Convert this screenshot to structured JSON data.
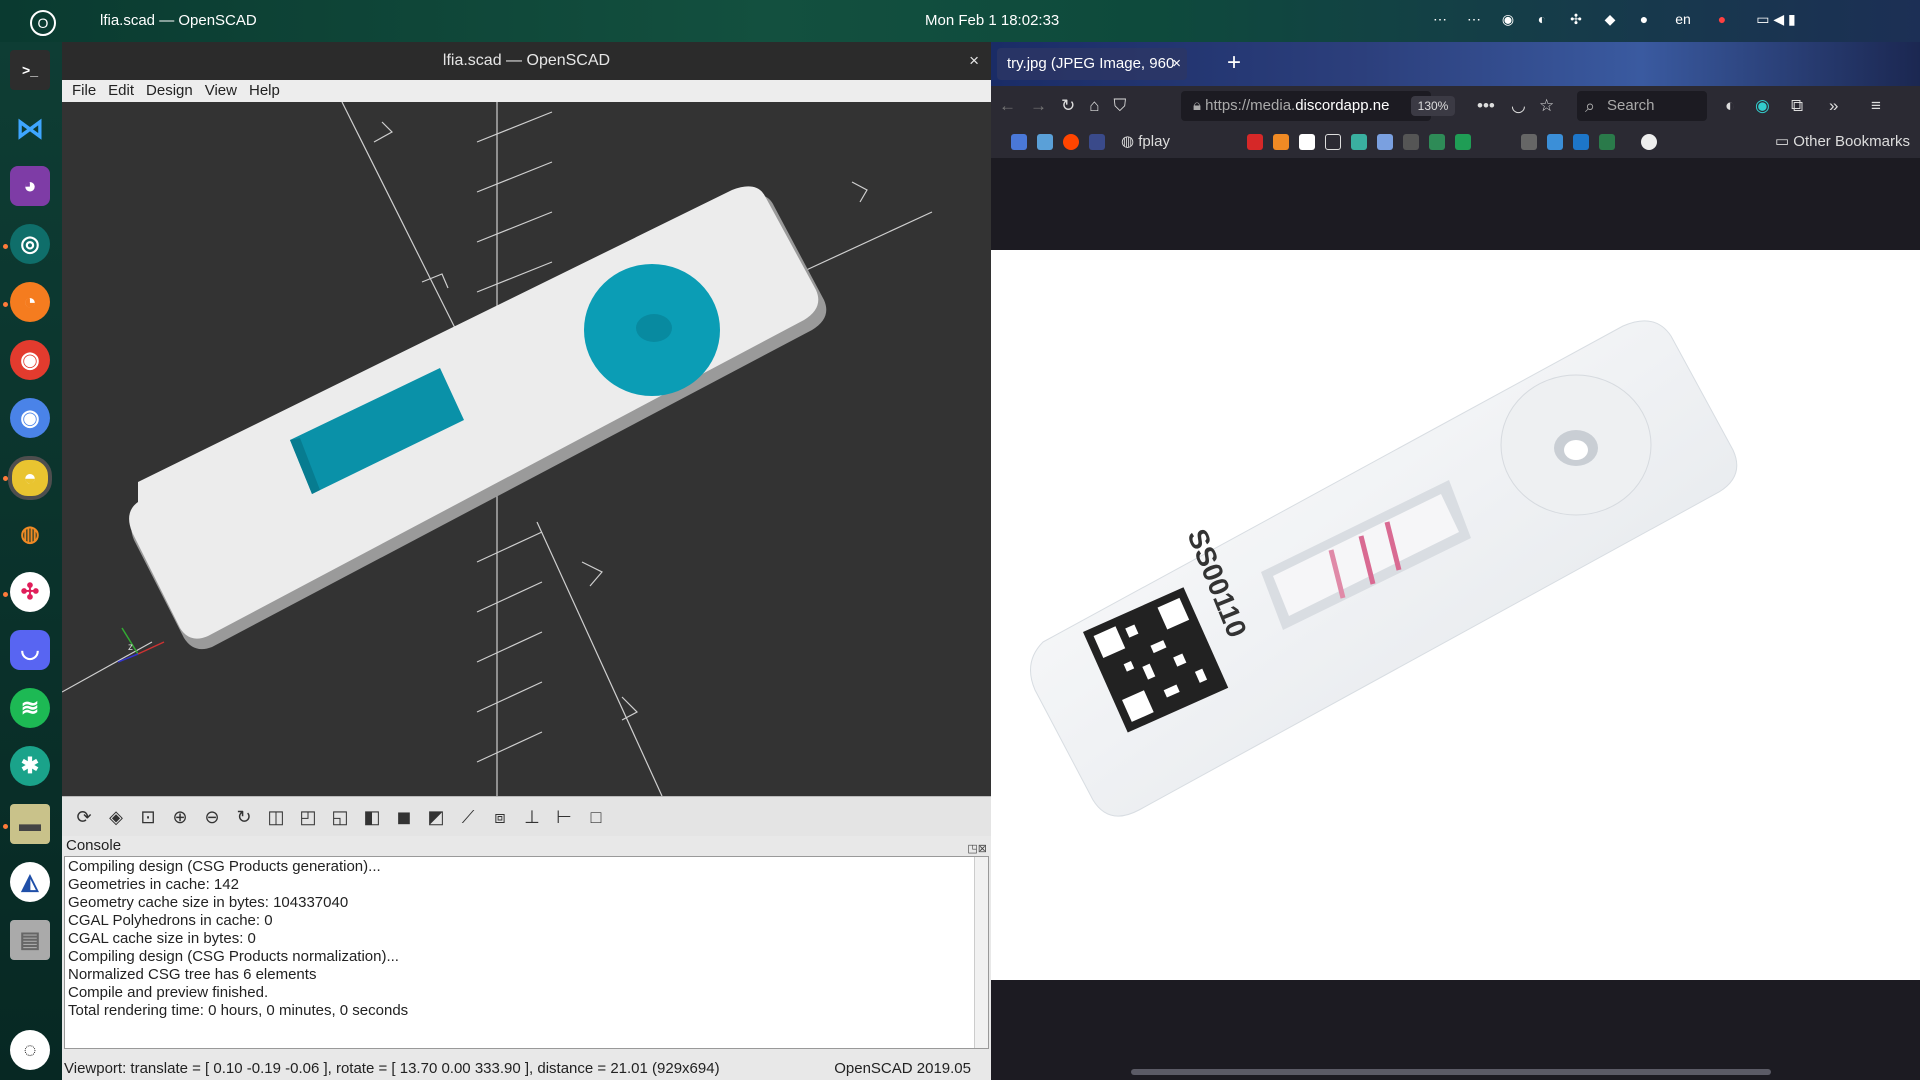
{
  "topbar": {
    "activities": "O",
    "window_title": "lfia.scad — OpenSCAD",
    "clock": "Mon Feb 1  18:02:33",
    "lang": "en"
  },
  "openscad": {
    "title": "lfia.scad — OpenSCAD",
    "close": "×",
    "menu": [
      "File",
      "Edit",
      "Design",
      "View",
      "Help"
    ],
    "console_title": "Console",
    "console_lines": [
      "Compiling design (CSG Products generation)...",
      "Geometries in cache: 142",
      "Geometry cache size in bytes: 104337040",
      "CGAL Polyhedrons in cache: 0",
      "CGAL cache size in bytes: 0",
      "Compiling design (CSG Products normalization)...",
      "Normalized CSG tree has 6 elements",
      "Compile and preview finished.",
      "Total rendering time: 0 hours, 0 minutes, 0 seconds"
    ],
    "status": "Viewport: translate = [ 0.10 -0.19 -0.06 ], rotate = [ 13.70 0.00 333.90 ], distance = 21.01 (929x694)",
    "version": "OpenSCAD 2019.05",
    "axis_label": "z",
    "colors": {
      "body": "#ececec",
      "teal": "#0b9db5",
      "bg": "#333333"
    }
  },
  "firefox": {
    "tab_title": "try.jpg (JPEG Image, 960 ×",
    "tab_close": "×",
    "new_tab": "+",
    "url_prefix": "https://media.",
    "url_domain": "discordapp.ne",
    "zoom": "130%",
    "search_placeholder": "Search",
    "bookmark_fplay": "fplay",
    "other_bookmarks": "Other Bookmarks",
    "cassette_code": "SS00110"
  }
}
